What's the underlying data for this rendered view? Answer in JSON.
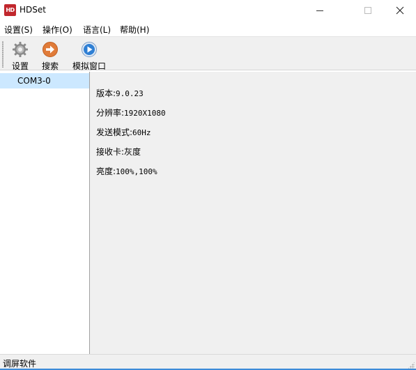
{
  "window": {
    "title": "HDSet",
    "logo_text": "HD",
    "minimize_label": "—",
    "close_label": "✕"
  },
  "menu": {
    "items": [
      {
        "label": "设置(S)"
      },
      {
        "label": "操作(O)"
      },
      {
        "label": "语言(L)"
      },
      {
        "label": "帮助(H)"
      }
    ]
  },
  "toolbar": {
    "settings_label": "设置",
    "search_label": "搜索",
    "simulate_label": "模拟窗口",
    "icons": {
      "settings": "gear-icon",
      "search": "arrow-right-circle-icon",
      "simulate": "play-icon"
    },
    "colors": {
      "gear": "#8a8a8a",
      "search": "#e07b39",
      "simulate": "#2f7fd4"
    }
  },
  "tree": {
    "items": [
      {
        "label": "COM3-0",
        "selected": true
      }
    ]
  },
  "info": {
    "version_label": "版本:",
    "version_value": "9.0.23",
    "resolution_label": "分辨率:",
    "resolution_value": "1920X1080",
    "send_mode_label": "发送模式:",
    "send_mode_value": "60Hz",
    "receiver_label": "接收卡:",
    "receiver_value": "灰度",
    "brightness_label": "亮度:",
    "brightness_value": "100%,100%"
  },
  "status": {
    "text": "调屏软件"
  }
}
